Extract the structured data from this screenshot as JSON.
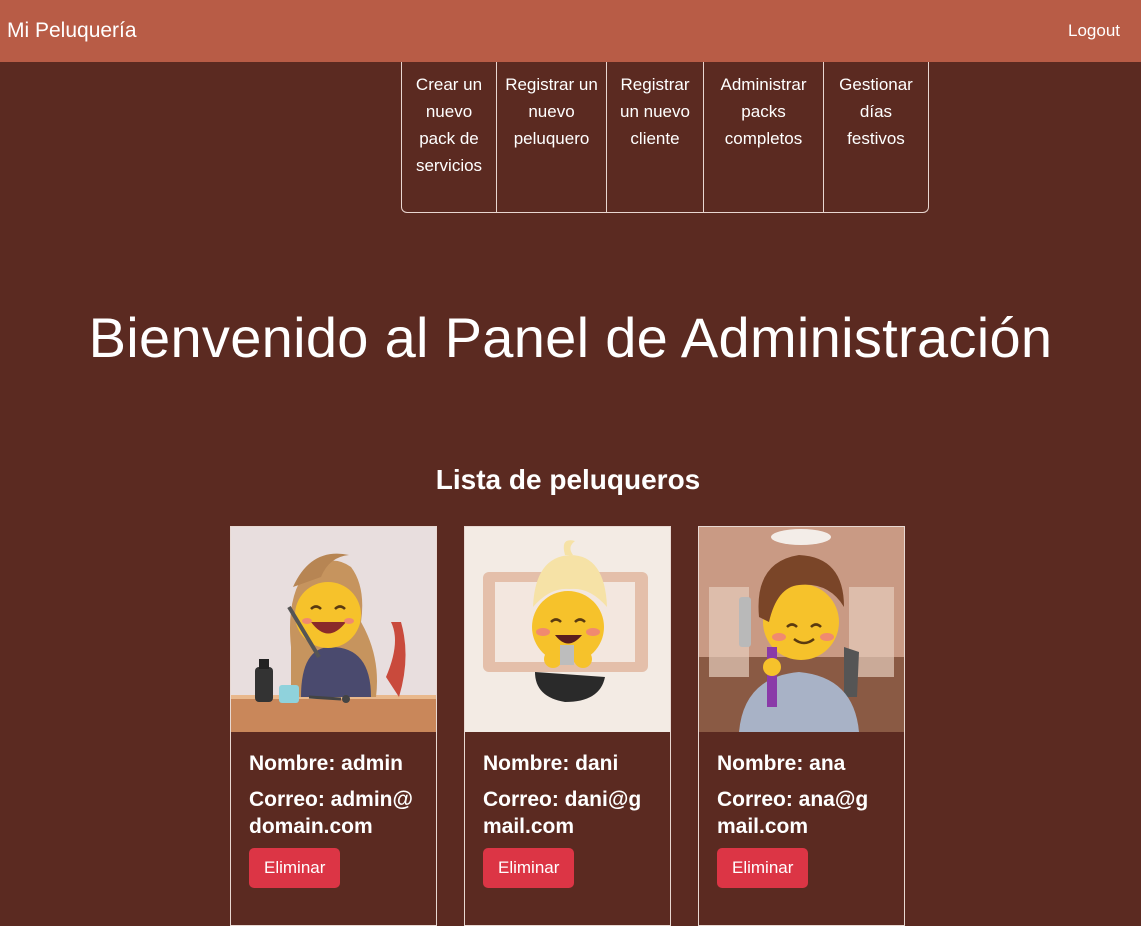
{
  "navbar": {
    "brand": "Mi Peluquería",
    "logout": "Logout"
  },
  "actions": [
    {
      "label": "Crear un nuevo pack de servicios"
    },
    {
      "label": "Registrar un nuevo peluquero"
    },
    {
      "label": "Registrar un nuevo cliente"
    },
    {
      "label": "Administrar packs completos"
    },
    {
      "label": "Gestionar días festivos"
    }
  ],
  "main": {
    "welcome": "Bienvenido al Panel de Administración",
    "list_title": "Lista de peluqueros"
  },
  "stylists": [
    {
      "name": "Nombre: admin",
      "email": "Correo: admin@domain.com",
      "delete_label": "Eliminar"
    },
    {
      "name": "Nombre: dani",
      "email": "Correo: dani@gmail.com",
      "delete_label": "Eliminar"
    },
    {
      "name": "Nombre: ana",
      "email": "Correo: ana@gmail.com",
      "delete_label": "Eliminar"
    }
  ],
  "colors": {
    "navbar": "#b85c46",
    "background": "#5b2a21",
    "danger": "#dc3545"
  }
}
